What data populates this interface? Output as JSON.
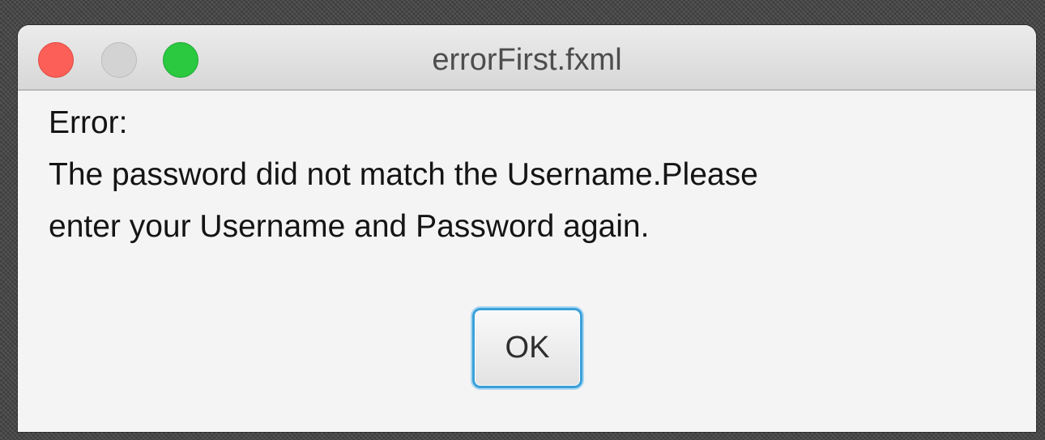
{
  "window": {
    "title": "errorFirst.fxml",
    "controls": {
      "close": "close-icon",
      "minimize": "minimize-icon",
      "zoom": "zoom-icon"
    }
  },
  "dialog": {
    "heading": "Error:",
    "message_line_1": "The password did not match the Username.Please",
    "message_line_2": "enter your Username and Password again.",
    "ok_label": "OK"
  },
  "colors": {
    "close": "#fc5f57",
    "minimize": "#d3d3d3",
    "zoom": "#2ac940",
    "focus_ring": "#3aa0d9",
    "window_background": "#f4f4f4"
  }
}
